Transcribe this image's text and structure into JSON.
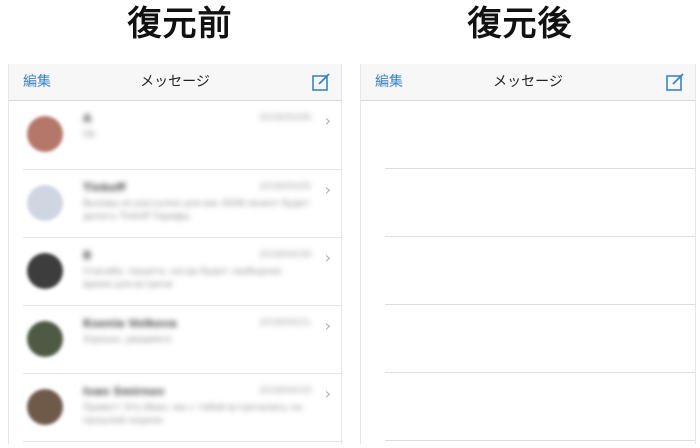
{
  "headings": {
    "before": "復元前",
    "after": "復元後"
  },
  "navbar": {
    "edit_label": "編集",
    "title": "メッセージ",
    "compose_icon": "compose-icon"
  },
  "colors": {
    "accent": "#3b83c8",
    "navbar_bg": "#f7f7f8"
  },
  "conversations": [
    {
      "name": "A",
      "date": "2018/05/06",
      "preview": "Ok",
      "avatar": "#b5776a"
    },
    {
      "name": "Tinkoff",
      "date": "2018/05/05",
      "preview": "Вызовы из рассылки для вас 8206 может будет делать Tinkoff Тарифы",
      "avatar": "#cfd6e2"
    },
    {
      "name": "B",
      "date": "2018/04/28",
      "preview": "Спасибо, пишите, когда будет свободное время для встречи",
      "avatar": "#3d3d3d"
    },
    {
      "name": "Ksenia Volkova",
      "date": "2018/04/21",
      "preview": "Хорошо, увидимся",
      "avatar": "#4f5a45"
    },
    {
      "name": "Ivan Smirnov",
      "date": "2018/04/19",
      "preview": "Привет! Это Иван, мы с тобой встречались на прошлой неделе",
      "avatar": "#6f5a4a"
    }
  ]
}
